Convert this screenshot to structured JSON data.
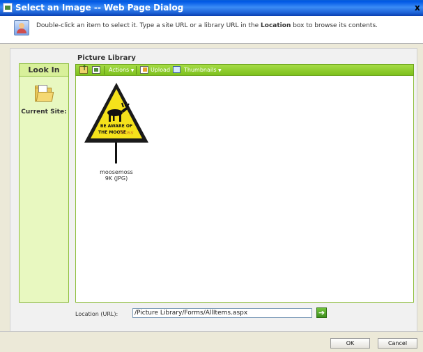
{
  "window": {
    "title": "Select an Image -- Web Page Dialog",
    "close_glyph": "x"
  },
  "instructions": {
    "before_bold": "Double-click an item to select it. Type a site URL or a library URL in the ",
    "bold": "Location",
    "after_bold": " box to browse its contents."
  },
  "look_in": {
    "heading": "Look In",
    "site_label": "Current Site:"
  },
  "library": {
    "title": "Picture Library"
  },
  "toolbar": {
    "actions_label": "Actions",
    "upload_label": "Upload",
    "thumbnails_label": "Thumbnails",
    "dropdown_glyph": "▼"
  },
  "items": [
    {
      "sign_line1": "BE AWARE OF",
      "sign_line2": "THE MOOSE",
      "sign_script": "Moss",
      "name": "moosemoss",
      "info": "9K (JPG)"
    }
  ],
  "location": {
    "label": "Location (URL):",
    "value": "/Picture Library/Forms/AllItems.aspx",
    "go_glyph": "➔"
  },
  "buttons": {
    "ok": "OK",
    "cancel": "Cancel"
  },
  "colors": {
    "titlebar": "#0a5fd8",
    "toolbar_green": "#7cc01c",
    "lookin_bg": "#e8f8c0",
    "sign_yellow": "#f5e21b"
  },
  "icons": {
    "instructions": "picture-icon",
    "site": "folder-icon",
    "up": "folder-up-icon",
    "new": "document-icon",
    "upload": "upload-icon",
    "thumbnails": "thumbnails-icon",
    "go": "go-arrow-icon"
  }
}
